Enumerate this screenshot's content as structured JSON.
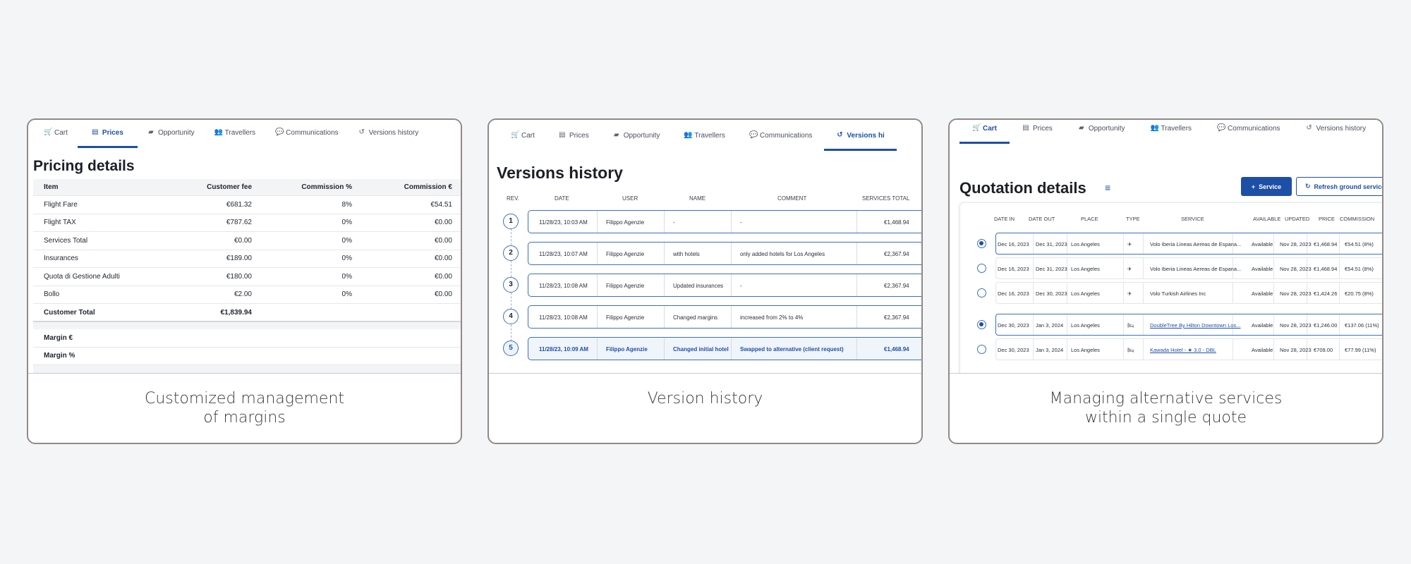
{
  "cards": [
    {
      "tabs": [
        {
          "label": "Cart",
          "icon": "cart-icon",
          "glyph": "🛒"
        },
        {
          "label": "Prices",
          "icon": "receipt-icon",
          "glyph": "▤",
          "active": true
        },
        {
          "label": "Opportunity",
          "icon": "folder-icon",
          "glyph": "▰"
        },
        {
          "label": "Travellers",
          "icon": "people-icon",
          "glyph": "👥"
        },
        {
          "label": "Communications",
          "icon": "chat-icon",
          "glyph": "💬"
        },
        {
          "label": "Versions history",
          "icon": "history-icon",
          "glyph": "↺"
        }
      ],
      "title": "Pricing details",
      "columns": [
        "Item",
        "Customer fee",
        "Commission %",
        "Commission €"
      ],
      "rows": [
        [
          "Flight Fare",
          "€681.32",
          "8%",
          "€54.51"
        ],
        [
          "Flight TAX",
          "€787.62",
          "0%",
          "€0.00"
        ],
        [
          "Services Total",
          "€0.00",
          "0%",
          "€0.00"
        ],
        [
          "Insurances",
          "€189.00",
          "0%",
          "€0.00"
        ],
        [
          "Quota di Gestione Adulti",
          "€180.00",
          "0%",
          "€0.00"
        ],
        [
          "Bollo",
          "€2.00",
          "0%",
          "€0.00"
        ]
      ],
      "total": {
        "label": "Customer Total",
        "value": "€1,839.94"
      },
      "margins": [
        "Margin €",
        "Margin %"
      ],
      "caption": [
        "Customized management",
        "of margins"
      ]
    },
    {
      "tabs": [
        {
          "label": "Cart",
          "icon": "cart-icon",
          "glyph": "🛒"
        },
        {
          "label": "Prices",
          "icon": "receipt-icon",
          "glyph": "▤"
        },
        {
          "label": "Opportunity",
          "icon": "folder-icon",
          "glyph": "▰"
        },
        {
          "label": "Travellers",
          "icon": "people-icon",
          "glyph": "👥"
        },
        {
          "label": "Communications",
          "icon": "chat-icon",
          "glyph": "💬"
        },
        {
          "label": "Versions hi",
          "icon": "history-icon",
          "glyph": "↺",
          "active": true
        }
      ],
      "title": "Versions history",
      "columns": [
        "REV.",
        "DATE",
        "USER",
        "NAME",
        "COMMENT",
        "SERVICES TOTAL"
      ],
      "rows": [
        {
          "rev": "1",
          "date": "11/28/23, 10:03 AM",
          "user": "Filippo Agenzie",
          "name": "-",
          "comment": "-",
          "total": "€1,468.94"
        },
        {
          "rev": "2",
          "date": "11/28/23, 10:07 AM",
          "user": "Filippo Agenzie",
          "name": "with hotels",
          "comment": "only added hotels for Los Angeles",
          "total": "€2,367.94"
        },
        {
          "rev": "3",
          "date": "11/28/23, 10:08 AM",
          "user": "Filippo Agenzie",
          "name": "Updated insurances",
          "comment": "-",
          "total": "€2,367.94"
        },
        {
          "rev": "4",
          "date": "11/28/23, 10:08 AM",
          "user": "Filippo Agenzie",
          "name": "Changed margins",
          "comment": "increased from 2% to 4%",
          "total": "€2,367.94"
        },
        {
          "rev": "5",
          "date": "11/28/23, 10:09 AM",
          "user": "Filippo Agenzie",
          "name": "Changed initial hotel",
          "comment": "Swapped to alternative (client request)",
          "total": "€1,468.94",
          "current": true
        }
      ],
      "caption": [
        "Version history"
      ]
    },
    {
      "tabs": [
        {
          "label": "Cart",
          "icon": "cart-icon",
          "glyph": "🛒",
          "active": true
        },
        {
          "label": "Prices",
          "icon": "receipt-icon",
          "glyph": "▤"
        },
        {
          "label": "Opportunity",
          "icon": "folder-icon",
          "glyph": "▰"
        },
        {
          "label": "Travellers",
          "icon": "people-icon",
          "glyph": "👥"
        },
        {
          "label": "Communications",
          "icon": "chat-icon",
          "glyph": "💬"
        },
        {
          "label": "Versions history",
          "icon": "history-icon",
          "glyph": "↺"
        }
      ],
      "title": "Quotation details",
      "filter_icon": "filter-icon",
      "service_button": "Service",
      "refresh_button": "Refresh ground services",
      "columns": [
        "DATE IN",
        "DATE OUT",
        "PLACE",
        "TYPE",
        "SERVICE",
        "AVAILABLE",
        "UPDATED",
        "PRICE",
        "COMMISSION"
      ],
      "rows": [
        {
          "selected": true,
          "date_in": "Dec 16, 2023",
          "date_out": "Dec 31, 2023",
          "place": "Los Angeles",
          "type": "flight",
          "glyph": "✈",
          "service": "Volo Iberia Lineas Aereas de Espana...",
          "available": "Available",
          "updated": "Nov 28, 2023",
          "price": "€1,468.94",
          "commission": "€54.51 (8%)"
        },
        {
          "selected": false,
          "date_in": "Dec 16, 2023",
          "date_out": "Dec 31, 2023",
          "place": "Los Angeles",
          "type": "flight",
          "glyph": "✈",
          "service": "Volo Iberia Lineas Aereas de Espana...",
          "available": "Available",
          "updated": "Nov 28, 2023",
          "price": "€1,468.94",
          "commission": "€54.51 (8%)"
        },
        {
          "selected": false,
          "date_in": "Dec 16, 2023",
          "date_out": "Dec 30, 2023",
          "place": "Los Angeles",
          "type": "flight",
          "glyph": "✈",
          "service": "Volo Turkish Airlines Inc",
          "available": "Available",
          "updated": "Nov 28, 2023",
          "price": "€1,424.26",
          "commission": "€20.75 (8%)"
        },
        {
          "selected": true,
          "date_in": "Dec 30, 2023",
          "date_out": "Jan 3, 2024",
          "place": "Los Angeles",
          "type": "hotel",
          "glyph": "🛏",
          "service": "DoubleTree By Hilton Downtown Los...",
          "link": true,
          "available": "Available",
          "updated": "Nov 28, 2023",
          "price": "€1,246.00",
          "commission": "€137.06 (11%)"
        },
        {
          "selected": false,
          "date_in": "Dec 30, 2023",
          "date_out": "Jan 3, 2024",
          "place": "Los Angeles",
          "type": "hotel",
          "glyph": "🛏",
          "service": "Kawada Hotel - ★ 3.0 - DBL",
          "link": true,
          "available": "Available",
          "updated": "Nov 28, 2023",
          "price": "€709.00",
          "commission": "€77.99 (11%)"
        }
      ],
      "caption": [
        "Managing alternative services",
        "within a single quote"
      ]
    }
  ],
  "colors": {
    "accent": "#1e4fa6",
    "border": "#8f8a88",
    "background": "#f4f5f7"
  }
}
